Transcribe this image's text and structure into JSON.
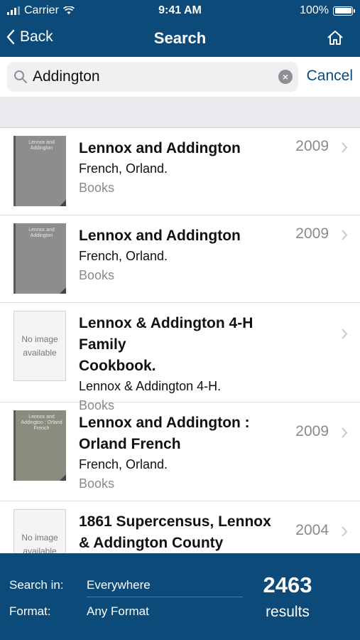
{
  "status_bar": {
    "carrier": "Carrier",
    "time": "9:41 AM",
    "battery": "100%"
  },
  "nav": {
    "back_label": "Back",
    "title": "Search"
  },
  "search": {
    "query": "Addington",
    "cancel_label": "Cancel"
  },
  "results": [
    {
      "title_lines": [
        "Lennox and Addington",
        ""
      ],
      "author": "French, Orland.",
      "format": "Books",
      "year": "2009",
      "thumb": "cover",
      "cover_text": "Lennox and Addington"
    },
    {
      "title_lines": [
        "Lennox and Addington",
        ""
      ],
      "author": "French, Orland.",
      "format": "Books",
      "year": "2009",
      "thumb": "cover",
      "cover_text": "Lennox and Addington"
    },
    {
      "title_lines": [
        "Lennox & Addington 4-H Family",
        "Cookbook."
      ],
      "author": "Lennox & Addington 4-H.",
      "format": "Books",
      "year": "",
      "thumb": "noimg",
      "noimg_text": "No image available"
    },
    {
      "title_lines": [
        "Lennox and Addington :",
        "Orland French"
      ],
      "author": "French, Orland.",
      "format": "Books",
      "year": "2009",
      "thumb": "cover",
      "cover_text": "Lennox and Addington : Orland French"
    },
    {
      "title_lines": [
        "1861 Supercensus, Lennox",
        "& Addington County"
      ],
      "author": "",
      "format": "",
      "year": "2004",
      "thumb": "noimg",
      "noimg_text": "No image available"
    }
  ],
  "footer": {
    "search_in_label": "Search in:",
    "search_in_value": "Everywhere",
    "format_label": "Format:",
    "format_value": "Any Format",
    "count": "2463",
    "results_label": "results"
  },
  "colors": {
    "brand": "#0b4a79",
    "muted": "#8a8a8a"
  }
}
